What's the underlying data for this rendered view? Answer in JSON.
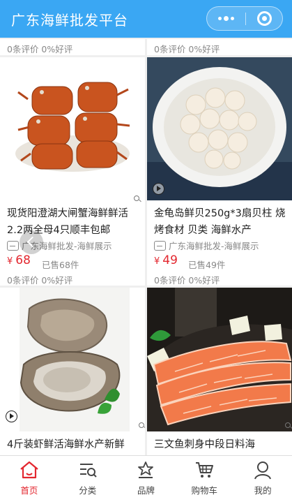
{
  "header": {
    "title": "广东海鲜批发平台"
  },
  "products": [
    {
      "review_text": "0条评价 0%好评"
    },
    {
      "review_text": "0条评价 0%好评"
    },
    {
      "name_line1": "现货阳澄湖大闸蟹海鲜鲜活",
      "name_line2": "2.2两全母4只顺丰包邮",
      "shop": "广东海鲜批发-海鲜展示",
      "currency": "¥",
      "price": "68",
      "sold": "已售68件",
      "review_text": "0条评价 0%好评"
    },
    {
      "name_line1": "金龟岛鲜贝250g*3扇贝柱 烧",
      "name_line2": "烤食材 贝类 海鲜水产",
      "shop": "广东海鲜批发-海鲜展示",
      "currency": "¥",
      "price": "49",
      "sold": "已售49件",
      "review_text": "0条评价 0%好评"
    },
    {
      "name_line1": "4斤装虾鲜活海鲜水产新鲜"
    },
    {
      "name_line1": "三文鱼刺身中段日料海"
    }
  ],
  "tabbar": [
    {
      "label": "首页",
      "icon": "home-icon",
      "active": true
    },
    {
      "label": "分类",
      "icon": "category-icon"
    },
    {
      "label": "品牌",
      "icon": "brand-icon"
    },
    {
      "label": "购物车",
      "icon": "cart-icon"
    },
    {
      "label": "我的",
      "icon": "profile-icon"
    }
  ],
  "colors": {
    "header_bg": "#3aa7f3",
    "price": "#e3272f",
    "active_tab": "#e3272f"
  }
}
